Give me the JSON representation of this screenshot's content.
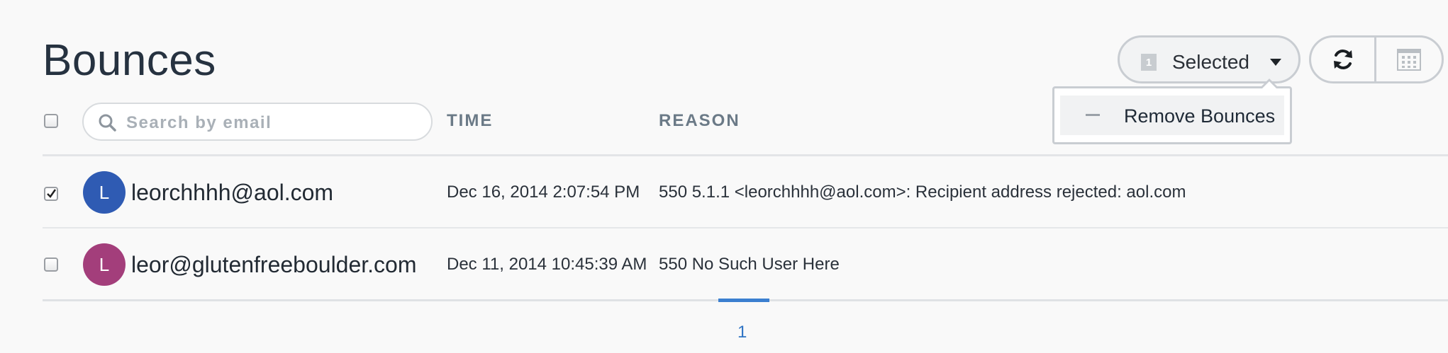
{
  "page": {
    "title": "Bounces"
  },
  "toolbar": {
    "selected_count": "1",
    "selected_label": "Selected",
    "refresh_icon": "refresh-icon",
    "calendar_icon": "calendar-icon"
  },
  "dropdown": {
    "items": [
      {
        "label": "Remove Bounces",
        "icon": "minus-icon"
      }
    ]
  },
  "search": {
    "placeholder": "Search by email"
  },
  "columns": {
    "time": "TIME",
    "reason": "REASON"
  },
  "rows": [
    {
      "checked": true,
      "initial": "L",
      "avatar_color": "#2f5bb3",
      "email": "leorchhhh@aol.com",
      "time": "Dec 16, 2014 2:07:54 PM",
      "reason": "550 5.1.1 <leorchhhh@aol.com>: Recipient address rejected: aol.com"
    },
    {
      "checked": false,
      "initial": "L",
      "avatar_color": "#a33e7b",
      "email": "leor@glutenfreeboulder.com",
      "time": "Dec 11, 2014 10:45:39 AM",
      "reason": "550 No Such User Here"
    }
  ],
  "pagination": {
    "current_page": "1"
  },
  "colors": {
    "accent": "#3b7fd0"
  }
}
